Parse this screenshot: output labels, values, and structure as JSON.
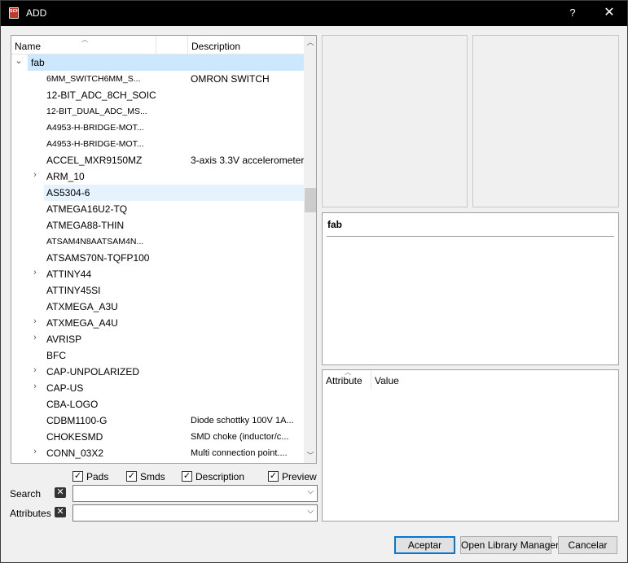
{
  "window": {
    "title": "ADD",
    "help_glyph": "?",
    "close_glyph": "✕",
    "icon_text": "SCH"
  },
  "tree": {
    "columns": {
      "name": "Name",
      "description": "Description"
    },
    "root": {
      "label": "fab"
    },
    "items": [
      {
        "name": "6MM_SWITCH6MM_S...",
        "description": "OMRON SWITCH",
        "expandable": false,
        "small": true
      },
      {
        "name": "12-BIT_ADC_8CH_SOIC",
        "description": "",
        "expandable": false
      },
      {
        "name": "12-BIT_DUAL_ADC_MS...",
        "description": "",
        "expandable": false,
        "small": true
      },
      {
        "name": "A4953-H-BRIDGE-MOT...",
        "description": "",
        "expandable": false,
        "small": true
      },
      {
        "name": "A4953-H-BRIDGE-MOT...",
        "description": "",
        "expandable": false,
        "small": true
      },
      {
        "name": "ACCEL_MXR9150MZ",
        "description": "3-axis 3.3V accelerometer",
        "expandable": false
      },
      {
        "name": "ARM_10",
        "description": "",
        "expandable": true
      },
      {
        "name": "AS5304-6",
        "description": "",
        "expandable": false,
        "highlighted": true
      },
      {
        "name": "ATMEGA16U2-TQ",
        "description": "",
        "expandable": false
      },
      {
        "name": "ATMEGA88-THIN",
        "description": "",
        "expandable": false
      },
      {
        "name": "ATSAM4N8AATSAM4N...",
        "description": "",
        "expandable": false,
        "small": true
      },
      {
        "name": "ATSAMS70N-TQFP100",
        "description": "",
        "expandable": false
      },
      {
        "name": "ATTINY44",
        "description": "",
        "expandable": true
      },
      {
        "name": "ATTINY45SI",
        "description": "",
        "expandable": false
      },
      {
        "name": "ATXMEGA_A3U",
        "description": "",
        "expandable": false
      },
      {
        "name": "ATXMEGA_A4U",
        "description": "",
        "expandable": true
      },
      {
        "name": "AVRISP",
        "description": "",
        "expandable": true
      },
      {
        "name": "BFC",
        "description": "",
        "expandable": false
      },
      {
        "name": "CAP-UNPOLARIZED",
        "description": "",
        "expandable": true
      },
      {
        "name": "CAP-US",
        "description": "",
        "expandable": true
      },
      {
        "name": "CBA-LOGO",
        "description": "",
        "expandable": false
      },
      {
        "name": "CDBM1100-G",
        "description": "Diode schottky 100V 1A...",
        "expandable": false,
        "small_desc": true
      },
      {
        "name": "CHOKESMD",
        "description": "SMD choke (inductor/c...",
        "expandable": false,
        "small_desc": true
      },
      {
        "name": "CONN_03X2",
        "description": "Multi connection point....",
        "expandable": true,
        "small_desc": true
      }
    ]
  },
  "options": {
    "pads": {
      "label": "Pads",
      "checked": true
    },
    "smds": {
      "label": "Smds",
      "checked": true
    },
    "description": {
      "label": "Description",
      "checked": true
    },
    "preview": {
      "label": "Preview",
      "checked": true
    }
  },
  "search": {
    "label": "Search",
    "value": ""
  },
  "attributes_filter": {
    "label": "Attributes",
    "value": ""
  },
  "description_panel": {
    "title": "fab"
  },
  "attribute_table": {
    "columns": {
      "attribute": "Attribute",
      "value": "Value"
    }
  },
  "buttons": {
    "accept": "Aceptar",
    "open_library_manager": "Open Library Manager",
    "cancel": "Cancelar"
  },
  "glyphs": {
    "checkmark": "✓",
    "clear": "✕",
    "dropdown": "⌵"
  }
}
